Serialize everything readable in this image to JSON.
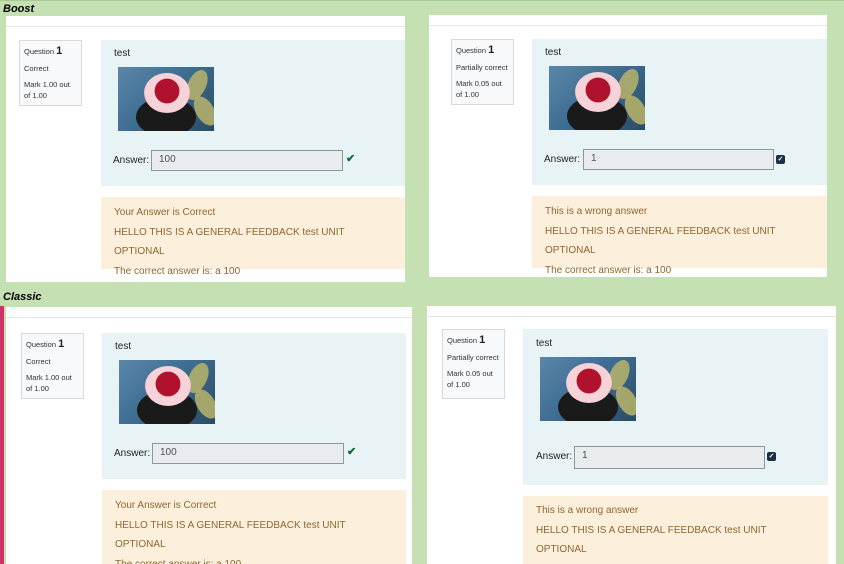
{
  "sections": {
    "top": "Boost",
    "bottom": "Classic"
  },
  "quiz": {
    "correct": {
      "question_word": "Question",
      "number": "1",
      "state": "Correct",
      "grade": "Mark 1.00 out of 1.00",
      "question_text": "test",
      "answer_label": "Answer:",
      "answer_value": "100",
      "feedback": [
        "Your Answer is Correct",
        "HELLO THIS IS A GENERAL FEEDBACK test UNIT OPTIONAL",
        "The correct answer is: a 100"
      ]
    },
    "partial": {
      "question_word": "Question",
      "number": "1",
      "state": "Partially correct",
      "grade": "Mark 0.05 out of 1.00",
      "question_text": "test",
      "answer_label": "Answer:",
      "answer_value": "1",
      "feedback": [
        "This is a wrong answer",
        "HELLO THIS IS A GENERAL FEEDBACK test UNIT OPTIONAL",
        "The correct answer is: a 100"
      ]
    }
  },
  "icons": {
    "correct": "check-icon",
    "partial": "partial-correct-icon"
  },
  "colors": {
    "background": "#c5e0b3",
    "formulation": "#e7f3f5",
    "feedback": "#fcefdc",
    "feedback_text": "#8e662e",
    "correct_tick": "#0f6e2f"
  }
}
